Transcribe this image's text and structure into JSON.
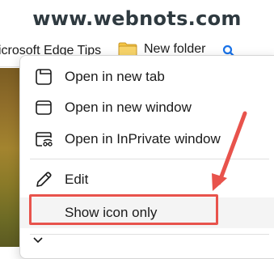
{
  "watermark": {
    "text": "www.webnots.com"
  },
  "favorites_bar": {
    "items": [
      {
        "label": "icrosoft Edge Tips"
      },
      {
        "label": "New folder",
        "icon": "folder-icon"
      }
    ],
    "search_icon": "search-icon"
  },
  "context_menu": {
    "items": [
      {
        "label": "Open in new tab",
        "icon": "new-tab-icon"
      },
      {
        "label": "Open in new window",
        "icon": "new-window-icon"
      },
      {
        "label": "Open in InPrivate window",
        "icon": "inprivate-window-icon"
      },
      {
        "label": "Edit",
        "icon": "pencil-icon"
      },
      {
        "label": "Show icon only",
        "icon": "",
        "highlighted": true
      }
    ]
  },
  "annotation": {
    "color": "#e8534c"
  },
  "colors": {
    "accent_red": "#e8534c",
    "folder_yellow": "#f5c542",
    "search_blue": "#1a73e8"
  }
}
